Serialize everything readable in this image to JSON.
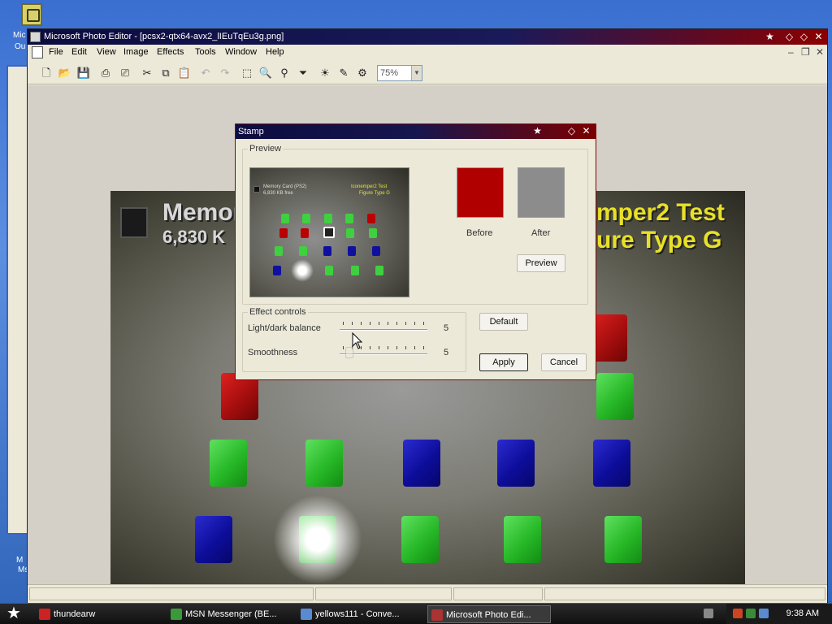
{
  "desktop": {
    "side_texts": [
      "Mic",
      "Ou",
      "M",
      "Ms"
    ]
  },
  "window": {
    "title": "Microsoft Photo Editor - [pcsx2-qtx64-avx2_lIEuTqEu3g.png]",
    "controls": [
      "★",
      "◇",
      "◇",
      "✕"
    ]
  },
  "menu": [
    "File",
    "Edit",
    "View",
    "Image",
    "Effects",
    "Tools",
    "Window",
    "Help"
  ],
  "mdi_controls": [
    "–",
    "❐",
    "✕"
  ],
  "toolbar": {
    "zoom_value": "75%",
    "tools": [
      {
        "icon": "new-icon",
        "glyph": "🗋",
        "enabled": true
      },
      {
        "icon": "open-icon",
        "glyph": "📂",
        "enabled": true
      },
      {
        "icon": "save-icon",
        "glyph": "💾",
        "enabled": false
      },
      {
        "icon": "print-icon",
        "glyph": "⎙",
        "enabled": true
      },
      {
        "icon": "scan-icon",
        "glyph": "⎚",
        "enabled": true
      },
      {
        "icon": "cut-icon",
        "glyph": "✂",
        "enabled": true
      },
      {
        "icon": "copy-icon",
        "glyph": "⧉",
        "enabled": true
      },
      {
        "icon": "paste-icon",
        "glyph": "📋",
        "enabled": false
      },
      {
        "icon": "undo-icon",
        "glyph": "↶",
        "enabled": false
      },
      {
        "icon": "redo-icon",
        "glyph": "↷",
        "enabled": false
      },
      {
        "icon": "select-icon",
        "glyph": "⬚",
        "enabled": true
      },
      {
        "icon": "zoom-icon",
        "glyph": "🔍",
        "enabled": true
      },
      {
        "icon": "pin-icon",
        "glyph": "⚲",
        "enabled": true
      },
      {
        "icon": "funnel-icon",
        "glyph": "⏷",
        "enabled": true
      },
      {
        "icon": "auto-balance-icon",
        "glyph": "☀",
        "enabled": true
      },
      {
        "icon": "brush-icon",
        "glyph": "✎",
        "enabled": true
      },
      {
        "icon": "effects-icon",
        "glyph": "⚙",
        "enabled": true
      }
    ]
  },
  "canvas": {
    "line1_left": "Memor",
    "line2_left": "6,830 K",
    "line1_right": "mper2 Test",
    "line2_right": "ure Type G"
  },
  "dialog": {
    "title": "Stamp",
    "preview_group": "Preview",
    "before_label": "Before",
    "after_label": "After",
    "preview_button": "Preview",
    "effect_group": "Effect controls",
    "light_dark_label": "Light/dark balance",
    "light_dark_value": "5",
    "smoothness_label": "Smoothness",
    "smoothness_value": "5",
    "default_button": "Default",
    "apply_button": "Apply",
    "cancel_button": "Cancel",
    "colors": {
      "before": "#b00000",
      "after": "#8c8c8c"
    }
  },
  "thumbnail_text": {
    "left": "Memory Card (PS2)",
    "left2": "6,830 KB free",
    "right": "Iconemper2 Test",
    "right2": "Figure Type G"
  },
  "taskbar": {
    "items": [
      {
        "label": "thundearw",
        "color": "#cc2222",
        "active": false
      },
      {
        "label": "MSN Messenger (BE...",
        "color": "#3a9a3a",
        "active": false
      },
      {
        "label": "yellows111 - Conve...",
        "color": "#5a8ad0",
        "active": false
      },
      {
        "label": "Microsoft Photo Edi...",
        "color": "#aa3333",
        "active": true
      }
    ],
    "clock": "9:38 AM"
  }
}
